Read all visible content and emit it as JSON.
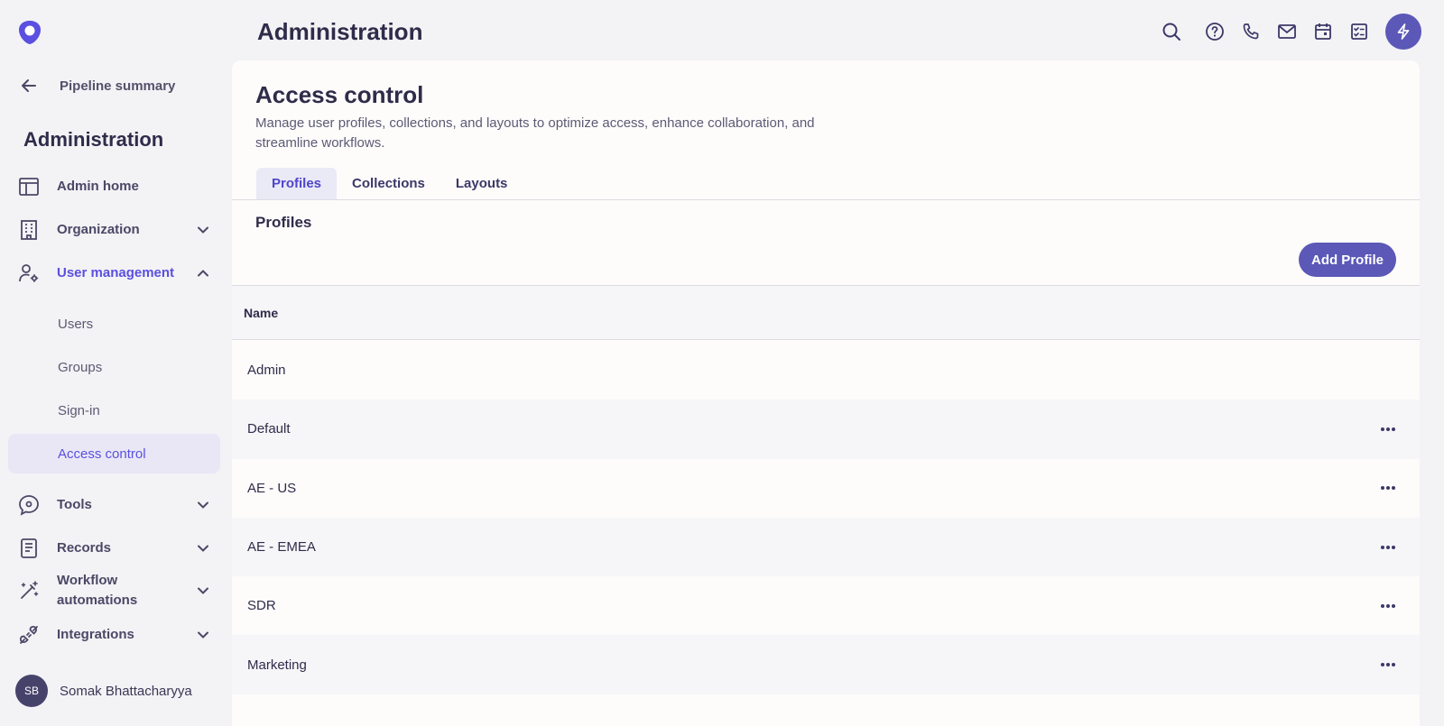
{
  "brand": {
    "accent": "#5a4fe0",
    "primary_button": "#5b58b7"
  },
  "sidebar": {
    "back_label": "Pipeline summary",
    "title": "Administration",
    "items": [
      {
        "label": "Admin home",
        "icon": "layout-icon"
      },
      {
        "label": "Organization",
        "icon": "building-icon",
        "expanded": false
      },
      {
        "label": "User management",
        "icon": "user-gear-icon",
        "expanded": true
      },
      {
        "label": "Tools",
        "icon": "tools-icon",
        "expanded": false
      },
      {
        "label": "Records",
        "icon": "records-icon",
        "expanded": false
      },
      {
        "label": "Workflow automations",
        "icon": "magic-wand-icon",
        "expanded": false
      },
      {
        "label": "Integrations",
        "icon": "plug-icon",
        "expanded": false
      }
    ],
    "sub_items": [
      "Users",
      "Groups",
      "Sign-in",
      "Access control"
    ],
    "selected_sub_item": "Access control",
    "user": {
      "initials": "SB",
      "name": "Somak Bhattacharyya"
    }
  },
  "header": {
    "title": "Administration",
    "icons": [
      "search-icon",
      "help-icon",
      "phone-icon",
      "mail-icon",
      "calendar-icon",
      "tasks-icon",
      "bolt-icon"
    ]
  },
  "main": {
    "title": "Access control",
    "description": "Manage user profiles, collections, and layouts to optimize access, enhance collaboration, and streamline workflows.",
    "tabs": [
      "Profiles",
      "Collections",
      "Layouts"
    ],
    "active_tab": "Profiles",
    "section_title": "Profiles",
    "add_button": "Add Profile",
    "table": {
      "columns": [
        "Name"
      ],
      "rows": [
        {
          "name": "Admin",
          "has_menu": false
        },
        {
          "name": "Default",
          "has_menu": true
        },
        {
          "name": "AE - US",
          "has_menu": true
        },
        {
          "name": "AE - EMEA",
          "has_menu": true
        },
        {
          "name": "SDR",
          "has_menu": true
        },
        {
          "name": "Marketing",
          "has_menu": true
        }
      ]
    }
  }
}
